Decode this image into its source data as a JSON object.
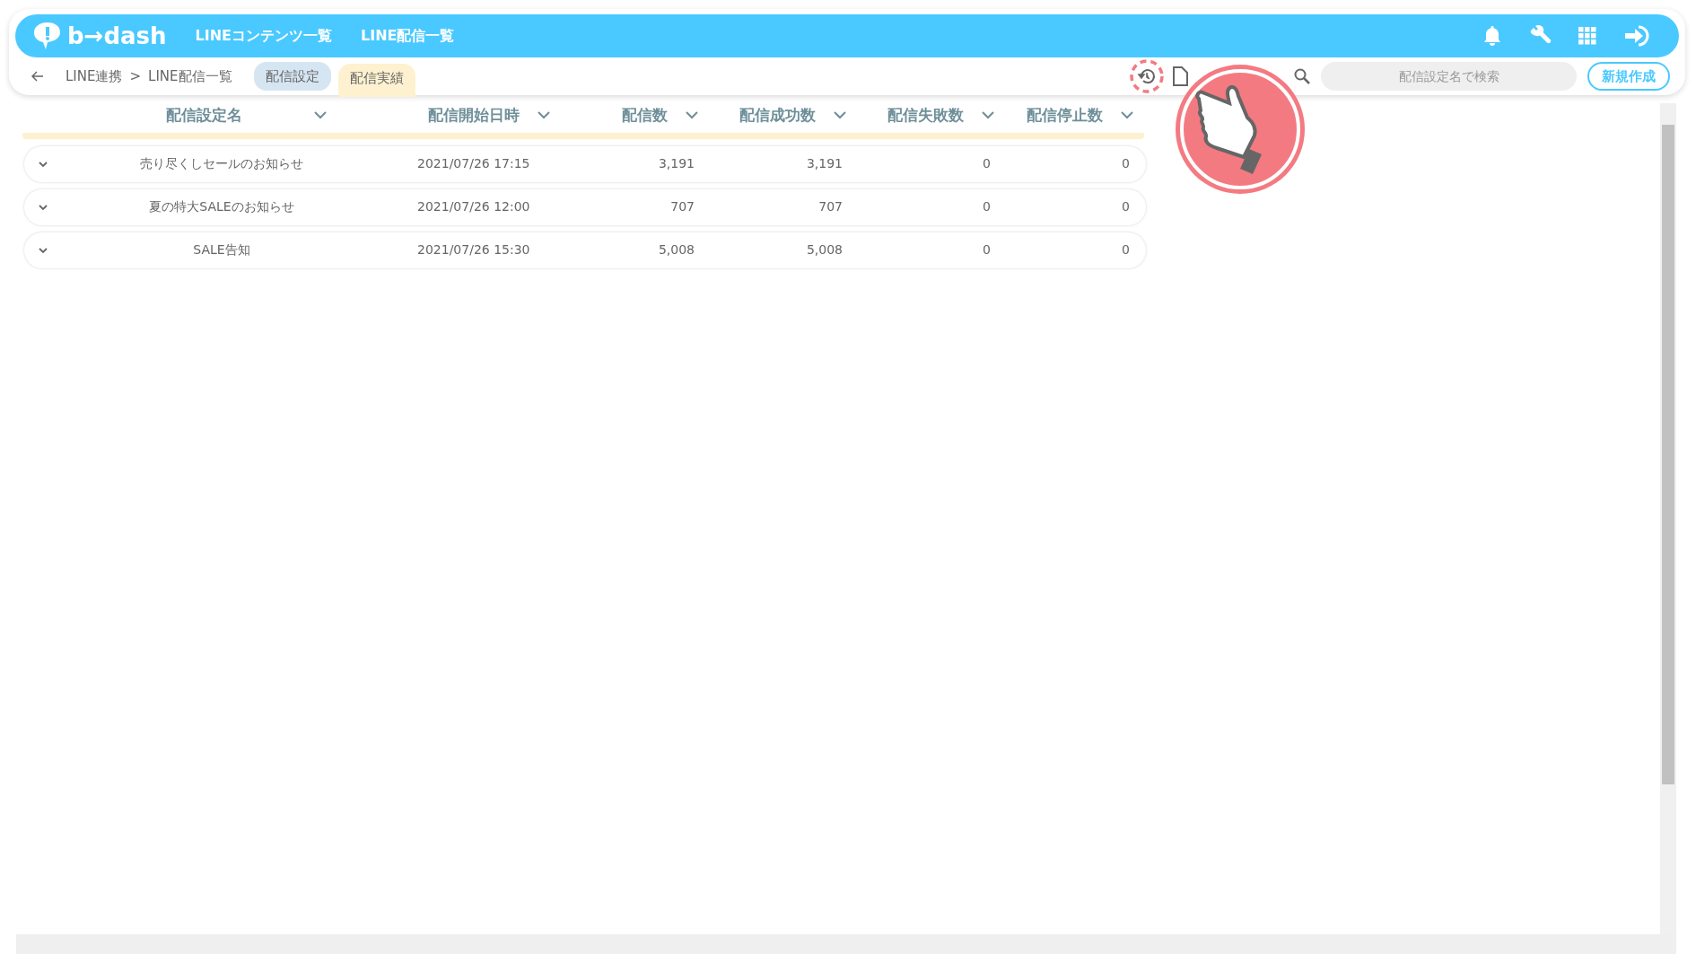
{
  "topbar": {
    "logo": "b→dash",
    "nav": [
      "LINEコンテンツ一覧",
      "LINE配信一覧"
    ]
  },
  "breadcrumb": [
    "LINE連携",
    ">",
    "LINE配信一覧"
  ],
  "tabs": [
    {
      "label": "配信設定",
      "selected": false
    },
    {
      "label": "配信実績",
      "selected": true
    }
  ],
  "search": {
    "placeholder": "配信設定名で検索"
  },
  "new_button": "新規作成",
  "table": {
    "columns": [
      "配信設定名",
      "配信開始日時",
      "配信数",
      "配信成功数",
      "配信失敗数",
      "配信停止数"
    ],
    "rows": [
      {
        "name": "売り尽くしセールのお知らせ",
        "start": "2021/07/26 17:15",
        "sent": "3,191",
        "success": "3,191",
        "failed": "0",
        "stopped": "0"
      },
      {
        "name": "夏の特大SALEのお知らせ",
        "start": "2021/07/26 12:00",
        "sent": "707",
        "success": "707",
        "failed": "0",
        "stopped": "0"
      },
      {
        "name": "SALE告知",
        "start": "2021/07/26 15:30",
        "sent": "5,008",
        "success": "5,008",
        "failed": "0",
        "stopped": "0"
      }
    ]
  }
}
